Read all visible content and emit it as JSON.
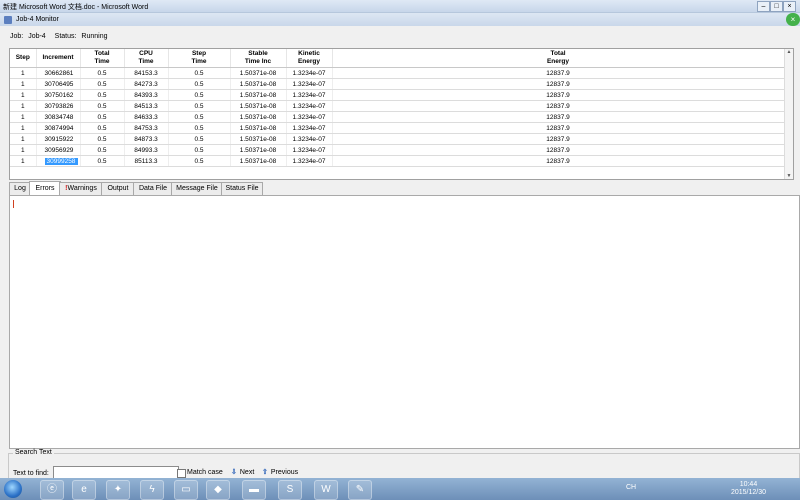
{
  "word_title": "新建 Microsoft Word 文档.doc - Microsoft Word",
  "monitor": {
    "title": "Job-4 Monitor",
    "job_label": "Job:",
    "job_value": "Job-4",
    "status_label": "Status:",
    "status_value": "Running"
  },
  "table": {
    "headers": [
      [
        "Step",
        ""
      ],
      [
        "Increment",
        ""
      ],
      [
        "Total",
        "Time"
      ],
      [
        "CPU",
        "Time"
      ],
      [
        "Step",
        "Time"
      ],
      [
        "Stable",
        "Time Inc"
      ],
      [
        "Kinetic",
        "Energy"
      ],
      [
        "Total",
        "Energy"
      ]
    ],
    "rows": [
      [
        "1",
        "30662861",
        "0.5",
        "84153.3",
        "0.5",
        "1.50371e-08",
        "1.3234e-07",
        "12837.9"
      ],
      [
        "1",
        "30706495",
        "0.5",
        "84273.3",
        "0.5",
        "1.50371e-08",
        "1.3234e-07",
        "12837.9"
      ],
      [
        "1",
        "30750162",
        "0.5",
        "84393.3",
        "0.5",
        "1.50371e-08",
        "1.3234e-07",
        "12837.9"
      ],
      [
        "1",
        "30793826",
        "0.5",
        "84513.3",
        "0.5",
        "1.50371e-08",
        "1.3234e-07",
        "12837.9"
      ],
      [
        "1",
        "30834748",
        "0.5",
        "84633.3",
        "0.5",
        "1.50371e-08",
        "1.3234e-07",
        "12837.9"
      ],
      [
        "1",
        "30874994",
        "0.5",
        "84753.3",
        "0.5",
        "1.50371e-08",
        "1.3234e-07",
        "12837.9"
      ],
      [
        "1",
        "30915922",
        "0.5",
        "84873.3",
        "0.5",
        "1.50371e-08",
        "1.3234e-07",
        "12837.9"
      ],
      [
        "1",
        "30956929",
        "0.5",
        "84993.3",
        "0.5",
        "1.50371e-08",
        "1.3234e-07",
        "12837.9"
      ],
      [
        "1",
        "30999258",
        "0.5",
        "85113.3",
        "0.5",
        "1.50371e-08",
        "1.3234e-07",
        "12837.9"
      ]
    ],
    "selected_row": 8
  },
  "tabs": {
    "log": "Log",
    "errors": "Errors",
    "warnings_mark": "!",
    "warnings": "Warnings",
    "output": "Output",
    "data_file": "Data File",
    "message_file": "Message File",
    "status_file": "Status File",
    "active": "Errors"
  },
  "search": {
    "legend": "Search Text",
    "find_label": "Text to find:",
    "find_value": "",
    "match_case": "Match case",
    "next": "Next",
    "previous": "Previous"
  },
  "taskbar": {
    "tray_lang": "CH",
    "time": "10:44",
    "date": "2015/12/30"
  },
  "colors": {
    "selection": "#3399ff",
    "close_button": "#44b14a",
    "taskbar": "#6d8fb8"
  }
}
